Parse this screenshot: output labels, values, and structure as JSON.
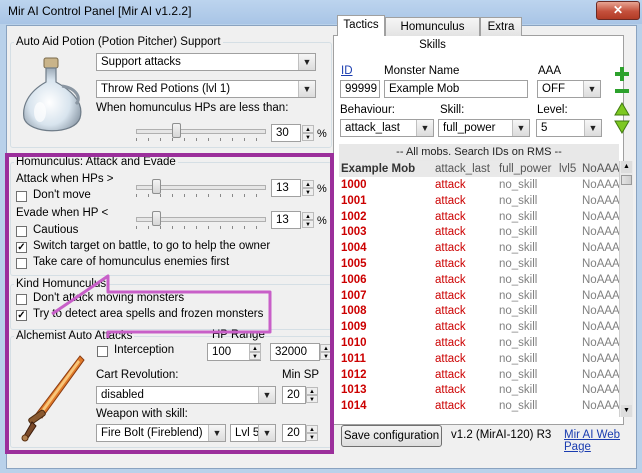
{
  "window": {
    "title": "Mir AI Control Panel [Mir AI v1.2.2]",
    "close": "✕"
  },
  "potion": {
    "group_label": "Auto Aid Potion (Potion Pitcher) Support",
    "mode": "Support attacks",
    "potion": "Throw Red Potions (lvl 1)",
    "when_label": "When homunculus HPs are less than:",
    "hp_percent": "30",
    "hp_level": 0.3,
    "pct": "%"
  },
  "attack_evade": {
    "group_label": "Homunculus: Attack and Evade",
    "attack_label": "Attack when HPs >",
    "attack_value": "13",
    "attack_level": 0.13,
    "dont_move": "Don't move",
    "dont_move_checked": false,
    "evade_label": "Evade when HP <",
    "evade_value": "13",
    "evade_level": 0.13,
    "cautious": "Cautious",
    "cautious_checked": false,
    "switch_target": "Switch target on battle, to go to help the owner",
    "switch_target_checked": true,
    "take_care": "Take care of homunculus enemies first",
    "take_care_checked": false,
    "pct": "%"
  },
  "kind": {
    "group_label": "Kind Homunculus",
    "dont_attack": "Don't attack moving monsters",
    "dont_attack_checked": false,
    "detect": "Try to detect area spells and frozen monsters",
    "detect_checked": true
  },
  "alchemist": {
    "group_label": "Alchemist Auto Attacks",
    "hp_range_label": "HP Range",
    "hp_min": "100",
    "hp_max": "32000",
    "interception": "Interception",
    "interception_checked": false,
    "cart_label": "Cart Revolution:",
    "cart_value": "disabled",
    "min_sp_label": "Min SP",
    "cart_sp": "20",
    "weapon_label": "Weapon with skill:",
    "weapon_value": "Fire Bolt (Fireblend)",
    "weapon_lvl": "Lvl 5",
    "weapon_sp": "20"
  },
  "tabs": [
    "Tactics",
    "Homunculus Skills",
    "Extra"
  ],
  "tactics": {
    "id_label": "ID",
    "name_label": "Monster Name",
    "aaa_label": "AAA",
    "id_value": "99999",
    "name_value": "Example Mob",
    "aaa_value": "OFF",
    "behaviour_label": "Behaviour:",
    "skill_label": "Skill:",
    "level_label": "Level:",
    "behaviour_value": "attack_last",
    "skill_value": "full_power",
    "level_value": "5",
    "list_header": "-- All mobs. Search IDs on RMS --",
    "columns": {
      "name": "Example Mob",
      "behaviour": "attack_last",
      "skill": "full_power",
      "level": "lvl5",
      "aaa": "NoAAA"
    },
    "rows": [
      {
        "id": "1000",
        "beh": "attack",
        "sk": "no_skill",
        "aaa": "NoAAA"
      },
      {
        "id": "1001",
        "beh": "attack",
        "sk": "no_skill",
        "aaa": "NoAAA"
      },
      {
        "id": "1002",
        "beh": "attack",
        "sk": "no_skill",
        "aaa": "NoAAA"
      },
      {
        "id": "1003",
        "beh": "attack",
        "sk": "no_skill",
        "aaa": "NoAAA"
      },
      {
        "id": "1004",
        "beh": "attack",
        "sk": "no_skill",
        "aaa": "NoAAA"
      },
      {
        "id": "1005",
        "beh": "attack",
        "sk": "no_skill",
        "aaa": "NoAAA"
      },
      {
        "id": "1006",
        "beh": "attack",
        "sk": "no_skill",
        "aaa": "NoAAA"
      },
      {
        "id": "1007",
        "beh": "attack",
        "sk": "no_skill",
        "aaa": "NoAAA"
      },
      {
        "id": "1008",
        "beh": "attack",
        "sk": "no_skill",
        "aaa": "NoAAA"
      },
      {
        "id": "1009",
        "beh": "attack",
        "sk": "no_skill",
        "aaa": "NoAAA"
      },
      {
        "id": "1010",
        "beh": "attack",
        "sk": "no_skill",
        "aaa": "NoAAA"
      },
      {
        "id": "1011",
        "beh": "attack",
        "sk": "no_skill",
        "aaa": "NoAAA"
      },
      {
        "id": "1012",
        "beh": "attack",
        "sk": "no_skill",
        "aaa": "NoAAA"
      },
      {
        "id": "1013",
        "beh": "attack",
        "sk": "no_skill",
        "aaa": "NoAAA"
      },
      {
        "id": "1014",
        "beh": "attack",
        "sk": "no_skill",
        "aaa": "NoAAA"
      }
    ]
  },
  "footer": {
    "save": "Save configuration",
    "version": "v1.2 (MirAI-120) R3",
    "web": "Mir AI Web Page"
  },
  "colors": {
    "highlight": "#9b2f9b",
    "arrow": "#c85fc8",
    "id_red": "#cc0000"
  },
  "icons": [
    "flask-icon",
    "sword-icon",
    "plus-icon",
    "minus-icon",
    "arrow-up-icon",
    "arrow-down-icon"
  ]
}
